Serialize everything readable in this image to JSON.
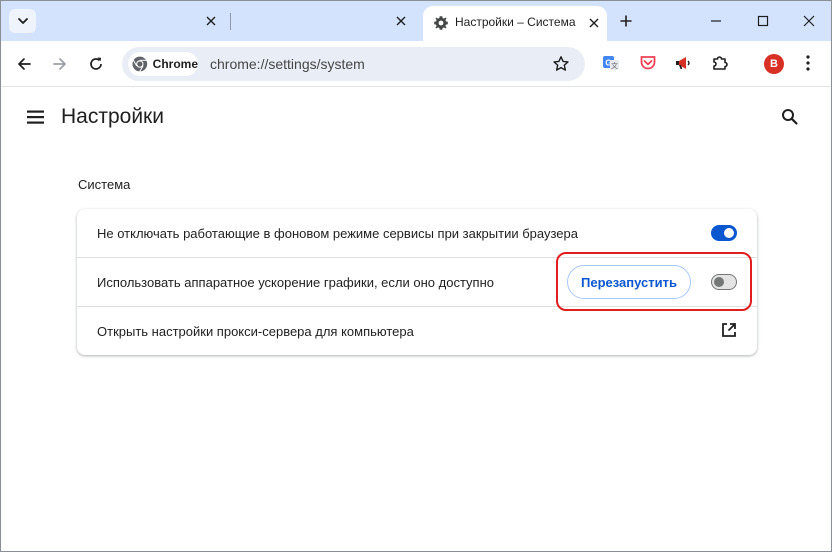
{
  "browser": {
    "tabs": [
      {
        "label": "",
        "active": false
      },
      {
        "label": "",
        "active": false
      },
      {
        "label": "Настройки – Система",
        "active": true
      }
    ],
    "omnibox": {
      "chip_label": "Chrome",
      "url": "chrome://settings/system"
    },
    "avatar_initial": "B",
    "extensions": [
      "translate-icon",
      "pocket-icon",
      "megaphone-icon",
      "puzzle-icon"
    ]
  },
  "page": {
    "title": "Настройки",
    "section_title": "Система",
    "rows": [
      {
        "label": "Не отключать работающие в фоновом режиме сервисы при закрытии браузера",
        "toggle": true
      },
      {
        "label": "Использовать аппаратное ускорение графики, если оно доступно",
        "toggle": false,
        "button": "Перезапустить"
      },
      {
        "label": "Открыть настройки прокси-сервера для компьютера",
        "action": "external-link-icon"
      }
    ]
  },
  "colors": {
    "accent": "#0b57d0",
    "tabstrip": "#d3e3fd",
    "highlight": "#e01e1e",
    "avatar": "#d93025"
  }
}
